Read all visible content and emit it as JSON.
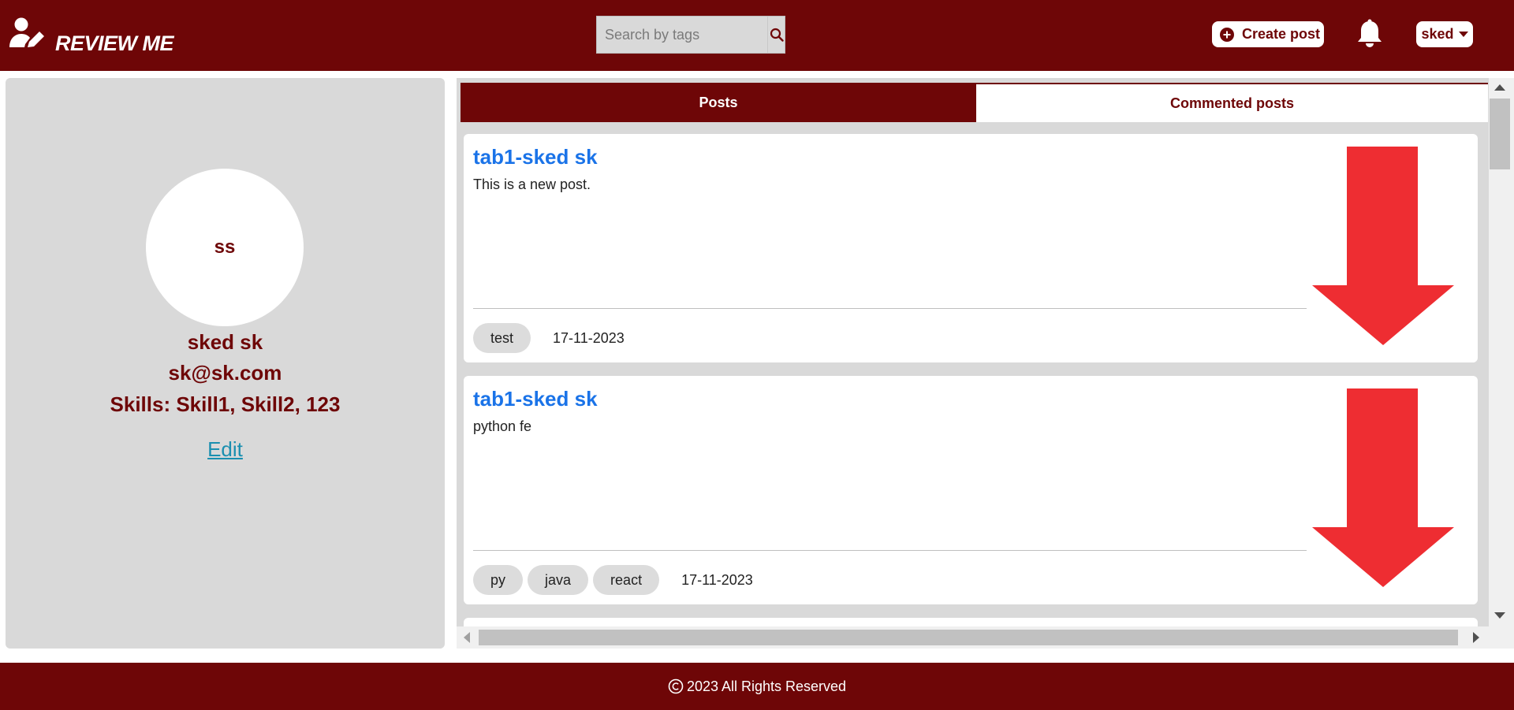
{
  "header": {
    "logo_text": "REVIEW ME",
    "search_placeholder": "Search by tags",
    "create_post_label": "Create post",
    "user_label": "sked",
    "brand_color": "#6e0607"
  },
  "profile": {
    "avatar_initials": "ss",
    "name": "sked sk",
    "email": "sk@sk.com",
    "skills": "Skills: Skill1, Skill2, 123",
    "edit_label": "Edit"
  },
  "tabs": [
    {
      "label": "Posts",
      "active": true
    },
    {
      "label": "Commented posts",
      "active": false
    }
  ],
  "posts": [
    {
      "title": "tab1-sked sk",
      "body": "This is a new post.",
      "tags": [
        "test"
      ],
      "date": "17-11-2023",
      "vote_icon": "red-down-arrow"
    },
    {
      "title": "tab1-sked sk",
      "body": "python fe",
      "tags": [
        "py",
        "java",
        "react"
      ],
      "date": "17-11-2023",
      "vote_icon": "red-down-arrow"
    }
  ],
  "footer": {
    "text": "2023 All Rights Reserved"
  }
}
